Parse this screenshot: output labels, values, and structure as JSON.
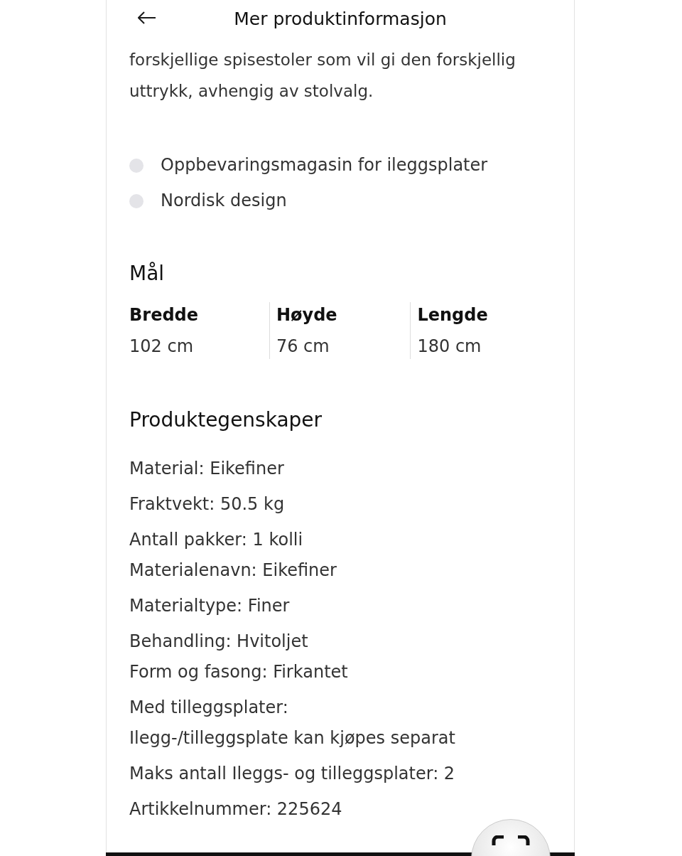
{
  "header": {
    "title": "Mer produktinformasjon"
  },
  "description": "forskjellige spisestoler som vil gi den forskjellig uttrykk, avhengig av stolvalg.",
  "features": [
    "Oppbevaringsmagasin for ileggsplater",
    "Nordisk design"
  ],
  "dimensions": {
    "heading": "Mål",
    "items": [
      {
        "label": "Bredde",
        "value": "102 cm"
      },
      {
        "label": "Høyde",
        "value": "76 cm"
      },
      {
        "label": "Lengde",
        "value": "180 cm"
      }
    ]
  },
  "properties": {
    "heading": "Produktegenskaper",
    "groups": [
      [
        "Material: Eikefiner"
      ],
      [
        "Fraktvekt: 50.5 kg"
      ],
      [
        "Antall pakker: 1 kolli",
        "Materialenavn: Eikefiner"
      ],
      [
        "Materialtype: Finer"
      ],
      [
        "Behandling: Hvitoljet",
        "Form og fasong: Firkantet"
      ],
      [
        "Med tilleggsplater:",
        "Ilegg-/tilleggsplate kan kjøpes separat"
      ],
      [
        "Maks antall Ileggs- og tilleggsplater: 2"
      ],
      [
        "Artikkelnummer: 225624"
      ]
    ]
  }
}
